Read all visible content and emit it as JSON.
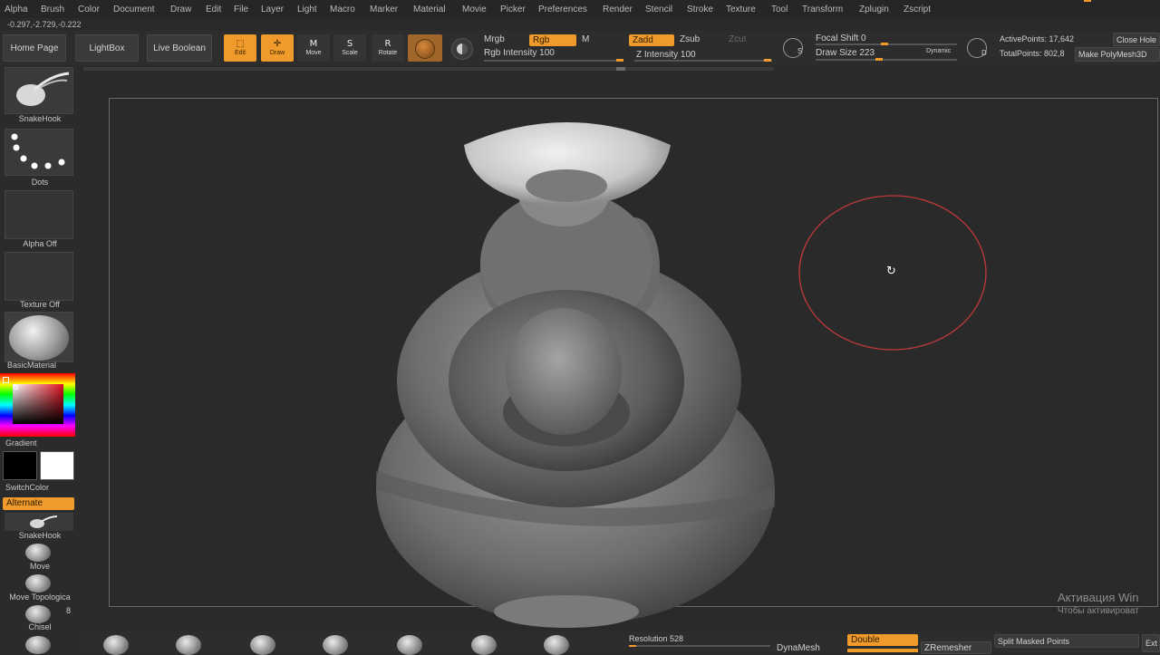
{
  "menu": [
    "Alpha",
    "Brush",
    "Color",
    "Document",
    "Draw",
    "Edit",
    "File",
    "Layer",
    "Light",
    "Macro",
    "Marker",
    "Material",
    "Movie",
    "Picker",
    "Preferences",
    "Render",
    "Stencil",
    "Stroke",
    "Texture",
    "Tool",
    "Transform",
    "Zplugin",
    "Zscript"
  ],
  "coords": "-0.297,-2.729,-0.222",
  "topshelf": {
    "home": "Home Page",
    "lightbox": "LightBox",
    "live_boolean": "Live Boolean",
    "modes": [
      "Edit",
      "Draw",
      "Move",
      "Scale",
      "Rotate"
    ],
    "mode_icons": [
      "M",
      "S",
      "R"
    ],
    "mrgb": "Mrgb",
    "rgb": "Rgb",
    "m": "M",
    "rgb_intensity": "Rgb Intensity 100",
    "zadd": "Zadd",
    "zsub": "Zsub",
    "zcut": "Zcut",
    "z_intensity": "Z Intensity 100",
    "focal_shift": "Focal Shift 0",
    "draw_size": "Draw Size 223",
    "dynamic": "Dynamic",
    "s_key": "S",
    "d_key": "D",
    "active_points": "ActivePoints: 17,642",
    "total_points": "TotalPoints: 802,8",
    "close_hole": "Close Hole",
    "make_polymesh": "Make PolyMesh3D"
  },
  "leftshelf": {
    "brush": "SnakeHook",
    "stroke": "Dots",
    "alpha": "Alpha Off",
    "texture": "Texture Off",
    "material": "BasicMaterial",
    "gradient": "Gradient",
    "switchcolor": "SwitchColor",
    "alternate": "Alternate",
    "brush2": "SnakeHook",
    "move": "Move",
    "move_topological": "Move Topologica",
    "count": "8",
    "chisel": "Chisel"
  },
  "bottom": {
    "resolution": "Resolution 528",
    "resolution_fraction": 0.05,
    "dynamesh": "DynaMesh",
    "double": "Double",
    "zremesher": "ZRemesher",
    "split_masked": "Split Masked Points",
    "ext": "Ext"
  },
  "watermark": {
    "line1": "Активация Win",
    "line2": "Чтобы активироват"
  },
  "colors": {
    "accent": "#f09a2b",
    "brush_ring": "#c0393b"
  }
}
